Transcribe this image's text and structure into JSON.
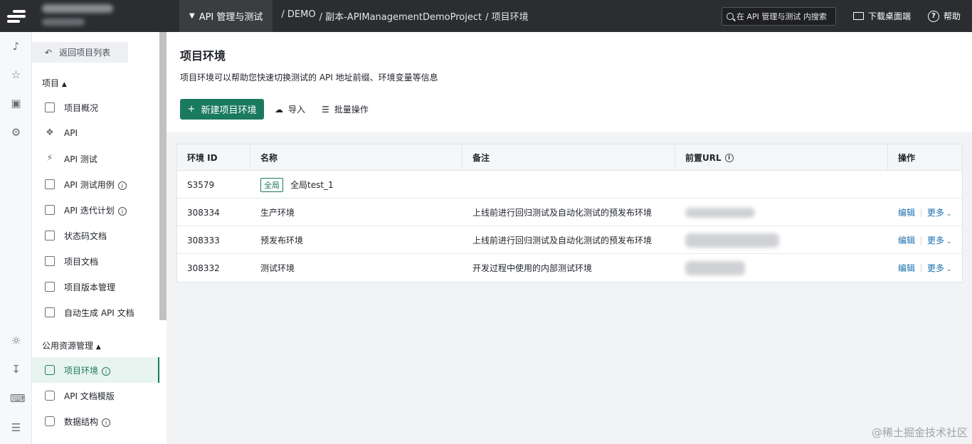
{
  "topbar": {
    "module": "API 管理与测试",
    "breadcrumb": [
      "/ DEMO",
      "/ 副本-APIManagementDemoProject",
      "/ 项目环境"
    ],
    "search_placeholder": "在 API 管理与测试 内搜索",
    "download": "下载桌面端",
    "help": "帮助"
  },
  "sidebar": {
    "back": "返回项目列表",
    "group_project": "项目",
    "items_project": [
      {
        "label": "项目概况",
        "icon": "overview-icon"
      },
      {
        "label": "API",
        "icon": "tag-icon"
      },
      {
        "label": "API 测试",
        "icon": "bolt-icon"
      },
      {
        "label": "API 测试用例",
        "icon": "clipboard-icon",
        "info": true
      },
      {
        "label": "API 迭代计划",
        "icon": "calendar-icon",
        "info": true
      },
      {
        "label": "状态码文档",
        "icon": "doc-icon"
      },
      {
        "label": "项目文档",
        "icon": "file-icon"
      },
      {
        "label": "项目版本管理",
        "icon": "version-icon"
      },
      {
        "label": "自动生成 API 文档",
        "icon": "robot-icon"
      }
    ],
    "group_public": "公用资源管理",
    "items_public": [
      {
        "label": "项目环境",
        "icon": "cube-icon",
        "info": true,
        "active": true
      },
      {
        "label": "API 文档模版",
        "icon": "cube-icon"
      },
      {
        "label": "数据结构",
        "icon": "cube-icon",
        "info": true
      }
    ]
  },
  "main": {
    "title": "项目环境",
    "description": "项目环境可以帮助您快速切换测试的 API 地址前缀、环境变量等信息",
    "new_button": "新建项目环境",
    "import": "导入",
    "batch": "批量操作"
  },
  "table": {
    "headers": [
      "环境 ID",
      "名称",
      "备注",
      "前置URL",
      "操作"
    ],
    "rows": [
      {
        "id": "S3579",
        "badge": "全局",
        "name": "全局test_1",
        "note": "",
        "has_url": false,
        "edit": "",
        "more": ""
      },
      {
        "id": "308334",
        "badge": "",
        "name": "生产环境",
        "note": "上线前进行回归测试及自动化测试的预发布环境",
        "has_url": true,
        "edit": "编辑",
        "more": "更多"
      },
      {
        "id": "308333",
        "badge": "",
        "name": "预发布环境",
        "note": "上线前进行回归测试及自动化测试的预发布环境",
        "has_url": true,
        "edit": "编辑",
        "more": "更多"
      },
      {
        "id": "308332",
        "badge": "",
        "name": "测试环境",
        "note": "开发过程中使用的内部测试环境",
        "has_url": true,
        "edit": "编辑",
        "more": "更多"
      }
    ]
  },
  "watermark": "@稀土掘金技术社区",
  "colors": {
    "accent": "#1a7a5e",
    "link": "#1a6fb0",
    "topbar": "#2b2d30"
  }
}
